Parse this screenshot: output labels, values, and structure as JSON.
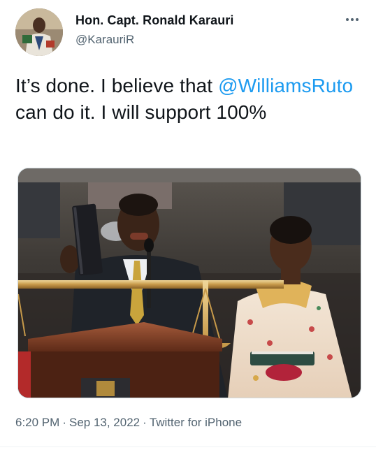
{
  "author": {
    "display_name": "Hon. Capt. Ronald Karauri",
    "handle": "@KarauriR"
  },
  "tweet": {
    "text_before": "It’s done. I believe that ",
    "mention": "@WilliamsRuto",
    "text_after": " can do it. I will support 100%"
  },
  "meta": {
    "time": "6:20 PM",
    "date": "Sep 13, 2022",
    "source": "Twitter for iPhone",
    "separator": "·"
  },
  "colors": {
    "link": "#1d9bf0",
    "secondary_text": "#536471",
    "primary_text": "#0f1419"
  },
  "icons": {
    "more": "more-horizontal-icon"
  }
}
